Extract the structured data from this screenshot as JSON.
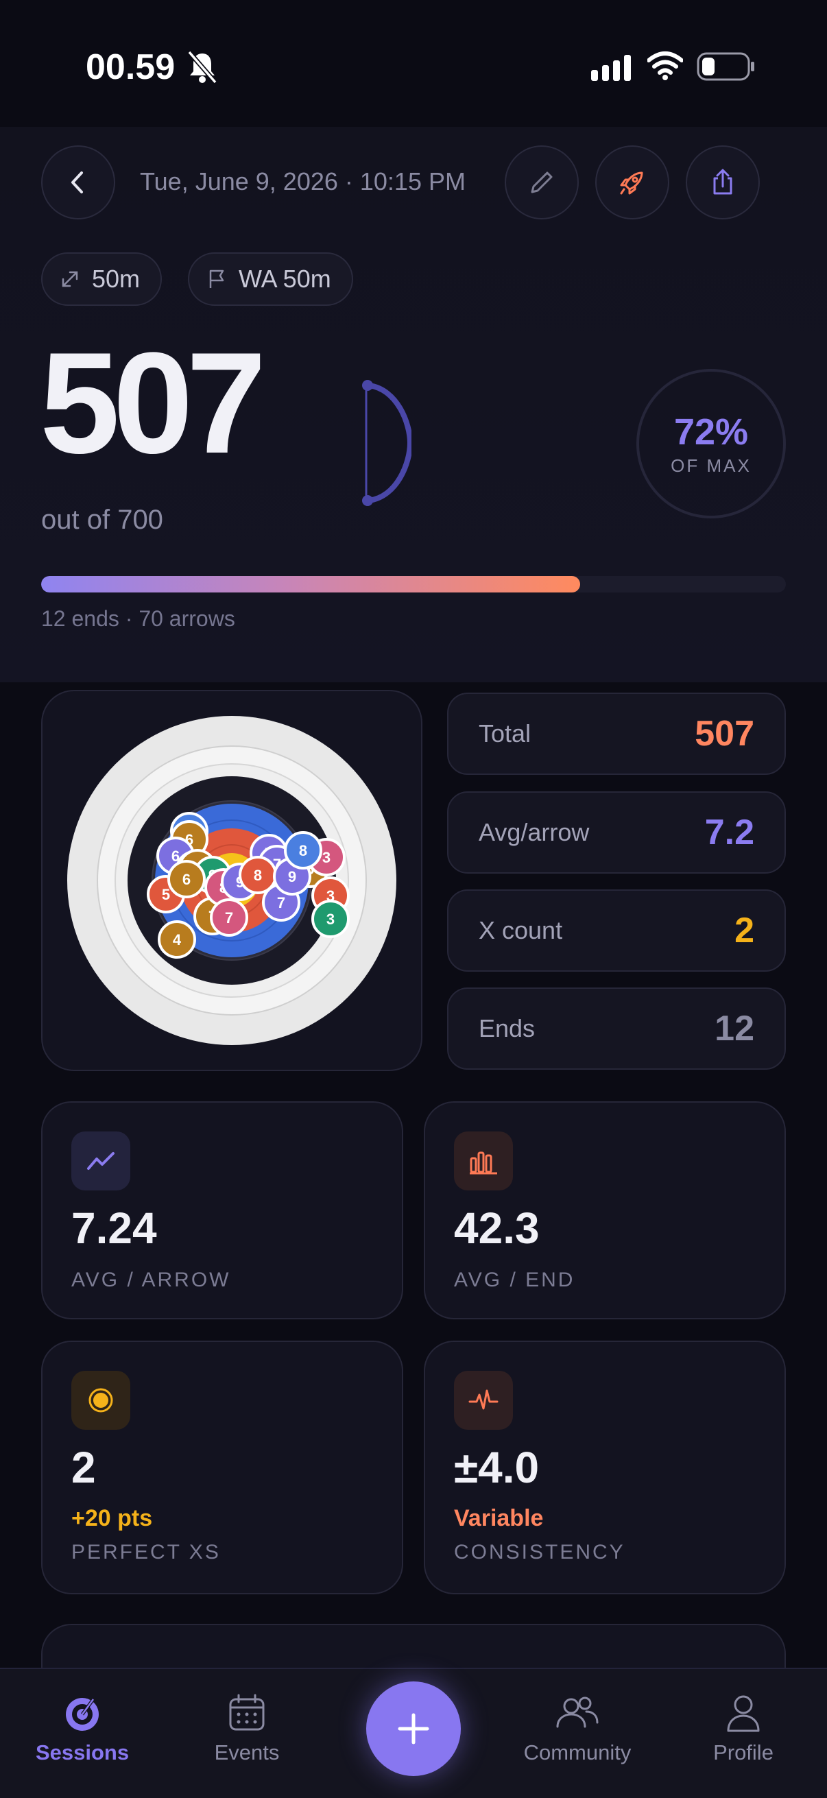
{
  "status_bar": {
    "time": "00.59"
  },
  "header": {
    "date": "Tue, June 9, 2026 · 10:15 PM",
    "chips": [
      {
        "icon": "resize-icon",
        "label": "50m"
      },
      {
        "icon": "flag-icon",
        "label": "WA 50m"
      }
    ]
  },
  "score": {
    "total": "507",
    "out_of": "out of 700",
    "percent": "72%",
    "percent_label": "OF MAX",
    "progress_fraction": 0.724,
    "caption": "12 ends · 70 arrows"
  },
  "target": {
    "arrows": [
      {
        "v": "6",
        "c": "#4a7fe0"
      },
      {
        "v": "6",
        "c": "#b87c1e"
      },
      {
        "v": "6",
        "c": "#7c6fe0"
      },
      {
        "v": "8",
        "c": "#7c6fe0"
      },
      {
        "v": "7",
        "c": "#7c6fe0"
      },
      {
        "v": "7",
        "c": "#7c6fe0"
      },
      {
        "v": "5",
        "c": "#b87c1e"
      },
      {
        "v": "3",
        "c": "#d4577e"
      },
      {
        "v": "3",
        "c": "#e0573c"
      },
      {
        "v": "3",
        "c": "#1f9a6e"
      },
      {
        "v": "5",
        "c": "#e0573c"
      },
      {
        "v": "7",
        "c": "#7c6fe0"
      },
      {
        "v": "7",
        "c": "#b87c1e"
      },
      {
        "v": "4",
        "c": "#b87c1e"
      },
      {
        "v": "9",
        "c": "#b87c1e"
      },
      {
        "v": "9",
        "c": "#1f9a6e"
      },
      {
        "v": "8",
        "c": "#d4577e"
      },
      {
        "v": "9",
        "c": "#7c6fe0"
      },
      {
        "v": "8",
        "c": "#e0573c"
      },
      {
        "v": "7",
        "c": "#d4577e"
      },
      {
        "v": "6",
        "c": "#b87c1e"
      },
      {
        "v": "9",
        "c": "#7c6fe0"
      },
      {
        "v": "8",
        "c": "#4a7fe0"
      }
    ]
  },
  "stats": [
    {
      "label": "Total",
      "value": "507",
      "color": "#ff8660"
    },
    {
      "label": "Avg/arrow",
      "value": "7.2",
      "color": "#8b7cf0"
    },
    {
      "label": "X count",
      "value": "2",
      "color": "#f5b21a"
    },
    {
      "label": "Ends",
      "value": "12",
      "color": "#8b8ba3"
    }
  ],
  "metrics": [
    {
      "icon": "trend-icon",
      "value": "7.24",
      "note": "",
      "label": "AVG / ARROW"
    },
    {
      "icon": "bar-chart-icon",
      "value": "42.3",
      "note": "",
      "label": "AVG / END"
    },
    {
      "icon": "bullseye-icon",
      "value": "2",
      "note": "+20 pts",
      "label": "PERFECT XS",
      "note_color": "#f5b21a"
    },
    {
      "icon": "pulse-icon",
      "value": "±4.0",
      "note": "Variable",
      "label": "CONSISTENCY",
      "note_color": "#ff8660"
    }
  ],
  "nav": {
    "items": [
      {
        "label": "Sessions",
        "icon": "target-icon",
        "active": true
      },
      {
        "label": "Events",
        "icon": "calendar-icon",
        "active": false
      },
      {
        "label": "Community",
        "icon": "people-icon",
        "active": false
      },
      {
        "label": "Profile",
        "icon": "person-icon",
        "active": false
      }
    ],
    "accent": "#8877f0"
  }
}
